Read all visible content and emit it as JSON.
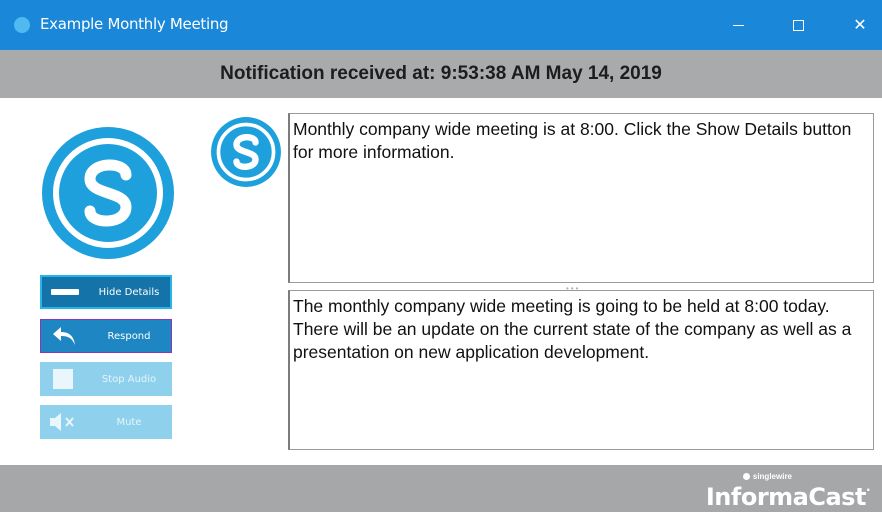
{
  "window": {
    "title": "Example Monthly Meeting",
    "minimize_glyph": "",
    "close_glyph": "✕"
  },
  "notification": {
    "received_text": "Notification received at: 9:53:38 AM May 14, 2019"
  },
  "message": {
    "summary": "Monthly company wide meeting is at 8:00. Click the Show Details button for more information.",
    "details": "The monthly company wide meeting is going to be held at 8:00 today. There will be an update on the current state of the company as well as a presentation on new application development."
  },
  "actions": {
    "hide_details": "Hide Details",
    "respond": "Respond",
    "stop_audio": "Stop Audio",
    "mute": "Mute"
  },
  "icons": {
    "app": "singlewire-logo-icon",
    "hide_details": "minus-bar-icon",
    "respond": "reply-arrow-icon",
    "stop_audio": "stop-square-icon",
    "mute": "speaker-muted-icon"
  },
  "footer": {
    "brand_small": "singlewire",
    "brand_big": "InformaCast",
    "trademark": "·"
  },
  "colors": {
    "titlebar": "#1a87d8",
    "accent": "#1ea0dc",
    "button_dark": "#1473a8",
    "button_disabled": "#8fd1ed",
    "footer": "#a6a7a8"
  }
}
